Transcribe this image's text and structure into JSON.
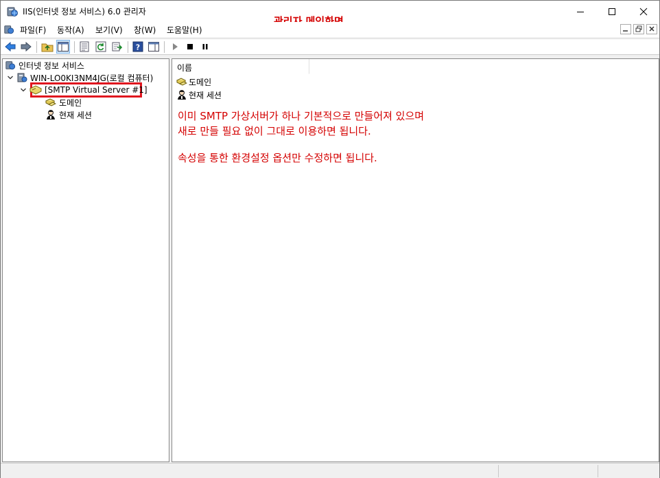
{
  "window": {
    "title": "IIS(인터넷 정보 서비스) 6.0 관리자"
  },
  "annotation_title": "관리자 메인화면",
  "menu": {
    "items": [
      "파일(F)",
      "동작(A)",
      "보기(V)",
      "창(W)",
      "도움말(H)"
    ]
  },
  "tree": {
    "root": "인터넷 정보 서비스",
    "computer": "WIN-LO0KI3NM4JG(로컬 컴퓨터)",
    "server": "[SMTP Virtual Server #1]",
    "domain": "도메인",
    "sessions": "현재 세션"
  },
  "list": {
    "column_name": "이름",
    "items": [
      "도메인",
      "현재 세션"
    ]
  },
  "annotation": {
    "line1": "이미 SMTP 가상서버가 하나 기본적으로 만들어져 있으며",
    "line2": "새로 만들 필요 없이 그대로 이용하면 됩니다.",
    "line3": "속성을 통한 환경설정 옵션만 수정하면 됩니다."
  },
  "colors": {
    "annotation_red": "#d40000",
    "highlight_border": "#e0141e"
  },
  "icons": [
    "iis-icon",
    "back-arrow-icon",
    "forward-arrow-icon",
    "up-folder-icon",
    "show-tree-icon",
    "properties-icon",
    "refresh-icon",
    "export-icon",
    "help-icon",
    "view-icon",
    "play-icon",
    "stop-icon",
    "pause-icon",
    "computer-icon",
    "smtp-server-icon",
    "domain-icon",
    "session-icon"
  ]
}
